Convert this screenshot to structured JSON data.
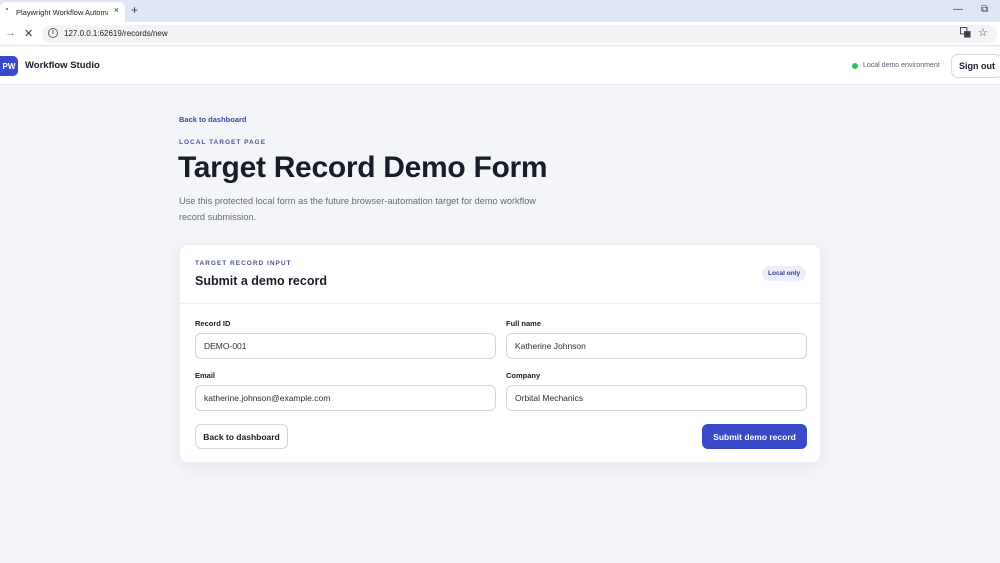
{
  "browser": {
    "tab_title": "Playwright Workflow Automati",
    "tab_close": "×",
    "new_tab": "+",
    "url": "127.0.0.1:62619/records/new",
    "icons": [
      "favicon-icon",
      "close-icon",
      "new-tab-icon",
      "minimize-icon",
      "restore-icon",
      "forward-icon",
      "stop-icon",
      "info-icon",
      "translate-icon",
      "star-icon"
    ]
  },
  "header": {
    "logo": "PW",
    "brand": "Workflow Studio",
    "env_status": "Local demo environment",
    "sign_out": "Sign out",
    "status_color": "#2cbf6a"
  },
  "page": {
    "back_link": "Back to dashboard",
    "eyebrow": "LOCAL TARGET PAGE",
    "title": "Target Record Demo Form",
    "description": "Use this protected local form as the future browser-automation target for demo workflow record submission."
  },
  "card": {
    "eyebrow": "TARGET RECORD INPUT",
    "title": "Submit a demo record",
    "badge": "Local only",
    "fields": {
      "record_id": {
        "label": "Record ID",
        "value": "DEMO-001"
      },
      "full_name": {
        "label": "Full name",
        "value": "Katherine Johnson"
      },
      "email": {
        "label": "Email",
        "value": "katherine.johnson@example.com"
      },
      "company": {
        "label": "Company",
        "value": "Orbital Mechanics"
      }
    },
    "back_button": "Back to dashboard",
    "submit_button": "Submit demo record"
  },
  "colors": {
    "accent": "#3849c9"
  }
}
